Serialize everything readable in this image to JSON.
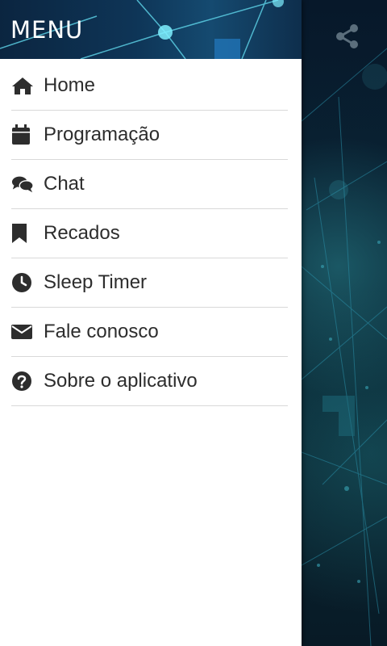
{
  "drawer": {
    "title": "MENU",
    "items": [
      {
        "label": "Home",
        "icon": "home-icon"
      },
      {
        "label": "Programação",
        "icon": "calendar-icon"
      },
      {
        "label": "Chat",
        "icon": "chat-icon"
      },
      {
        "label": "Recados",
        "icon": "bookmark-icon"
      },
      {
        "label": "Sleep Timer",
        "icon": "clock-icon"
      },
      {
        "label": "Fale conosco",
        "icon": "envelope-icon"
      },
      {
        "label": "Sobre o aplicativo",
        "icon": "question-circle-icon"
      }
    ]
  },
  "app": {
    "share_icon": "share-icon"
  },
  "colors": {
    "drawer_bg": "#ffffff",
    "menu_text": "#2d2d2d",
    "divider": "#d9d9d9",
    "header_bg": "#0e3557"
  }
}
